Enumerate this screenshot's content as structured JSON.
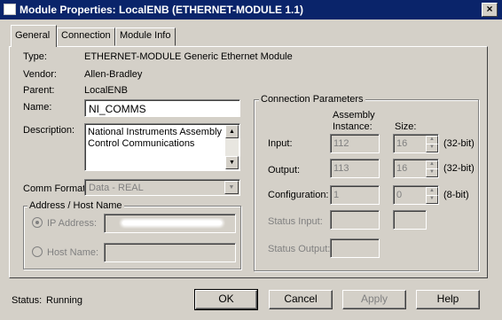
{
  "window": {
    "title": "Module Properties: LocalENB (ETHERNET-MODULE 1.1)",
    "close_glyph": "×"
  },
  "tabs": [
    {
      "label": "General",
      "active": true
    },
    {
      "label": "Connection",
      "active": false
    },
    {
      "label": "Module Info",
      "active": false
    }
  ],
  "general": {
    "type_label": "Type:",
    "type_value": "ETHERNET-MODULE Generic Ethernet Module",
    "vendor_label": "Vendor:",
    "vendor_value": "Allen-Bradley",
    "parent_label": "Parent:",
    "parent_value": "LocalENB",
    "name_label": "Name:",
    "name_value": "NI_COMMS",
    "description_label": "Description:",
    "description_value": "National Instruments Assembly\nControl Communications",
    "comm_format_label": "Comm Format:",
    "comm_format_value": "Data - REAL"
  },
  "address": {
    "group_title": "Address / Host Name",
    "ip_label": "IP Address:",
    "host_label": "Host Name:",
    "ip_selected": true
  },
  "connection_params": {
    "group_title": "Connection Parameters",
    "col_instance_line1": "Assembly",
    "col_instance_line2": "Instance:",
    "col_size": "Size:",
    "rows": [
      {
        "label": "Input:",
        "instance": "112",
        "size": "16",
        "unit": "(32-bit)"
      },
      {
        "label": "Output:",
        "instance": "113",
        "size": "16",
        "unit": "(32-bit)"
      },
      {
        "label": "Configuration:",
        "instance": "1",
        "size": "0",
        "unit": "(8-bit)"
      }
    ],
    "status_input_label": "Status Input:",
    "status_output_label": "Status Output:"
  },
  "footer": {
    "status_label": "Status:",
    "status_value": "Running",
    "ok": "OK",
    "cancel": "Cancel",
    "apply": "Apply",
    "help": "Help"
  },
  "icons": {
    "spin_up": "▲",
    "spin_down": "▼",
    "scroll_up": "▲",
    "scroll_down": "▼",
    "dropdown": "▼"
  }
}
